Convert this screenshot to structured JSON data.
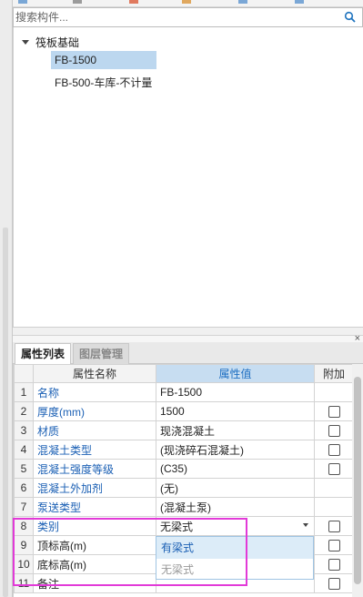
{
  "search": {
    "placeholder": "搜索构件..."
  },
  "tree": {
    "root_label": "筏板基础",
    "items": [
      {
        "label": "FB-1500",
        "selected": true
      },
      {
        "label": "FB-500-车库-不计量",
        "selected": false
      }
    ]
  },
  "panel": {
    "close_glyph": "×",
    "tabs": [
      {
        "label": "属性列表",
        "active": true
      },
      {
        "label": "图层管理",
        "active": false
      }
    ]
  },
  "grid": {
    "columns": {
      "num": "",
      "name": "属性名称",
      "value": "属性值",
      "extra": "附加"
    },
    "rows": [
      {
        "num": "1",
        "name": "名称",
        "value": "FB-1500",
        "has_check": false,
        "name_blue": true
      },
      {
        "num": "2",
        "name": "厚度(mm)",
        "value": "1500",
        "has_check": true,
        "name_blue": true
      },
      {
        "num": "3",
        "name": "材质",
        "value": "现浇混凝土",
        "has_check": true,
        "name_blue": true
      },
      {
        "num": "4",
        "name": "混凝土类型",
        "value": "(现浇碎石混凝土)",
        "has_check": true,
        "name_blue": true
      },
      {
        "num": "5",
        "name": "混凝土强度等级",
        "value": "(C35)",
        "has_check": true,
        "name_blue": true
      },
      {
        "num": "6",
        "name": "混凝土外加剂",
        "value": "(无)",
        "has_check": false,
        "name_blue": true
      },
      {
        "num": "7",
        "name": "泵送类型",
        "value": "(混凝土泵)",
        "has_check": false,
        "name_blue": true
      },
      {
        "num": "8",
        "name": "类别",
        "value": "无梁式",
        "has_check": true,
        "name_blue": true
      },
      {
        "num": "9",
        "name": "顶标高(m)",
        "value": "",
        "has_check": true,
        "name_blue": false
      },
      {
        "num": "10",
        "name": "底标高(m)",
        "value": "",
        "has_check": true,
        "name_blue": false
      },
      {
        "num": "11",
        "name": "备注",
        "value": "",
        "has_check": true,
        "name_blue": false
      }
    ]
  },
  "dropdown": {
    "options": [
      {
        "label": "有梁式",
        "state": "hover"
      },
      {
        "label": "无梁式",
        "state": "selected"
      }
    ]
  },
  "colors": {
    "highlight_box": "#e23ad8",
    "selection": "#bcd7ef",
    "link_blue": "#1a5fb4",
    "header_value_bg": "#c7ddf1"
  }
}
